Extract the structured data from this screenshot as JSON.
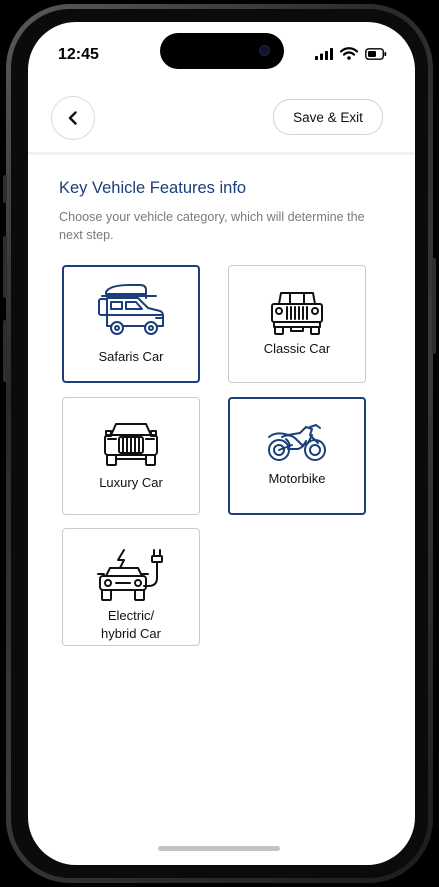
{
  "status_bar": {
    "time": "12:45"
  },
  "header": {
    "save_exit_label": "Save & Exit"
  },
  "content": {
    "title": "Key Vehicle Features info",
    "subtitle": "Choose your vehicle category, which will determine the next step."
  },
  "categories": [
    {
      "label": "Safaris Car",
      "icon": "safari-car-icon",
      "selected": true
    },
    {
      "label": "Classic Car",
      "icon": "classic-car-icon",
      "selected": false
    },
    {
      "label": "Luxury Car",
      "icon": "luxury-car-icon",
      "selected": false
    },
    {
      "label": "Motorbike",
      "icon": "motorbike-icon",
      "selected": true
    },
    {
      "label": "Electric/ hybrid Car",
      "label_lines": [
        "Electric/",
        "hybrid Car"
      ],
      "icon": "electric-car-icon",
      "selected": false
    }
  ],
  "colors": {
    "accent": "#1b3f7a",
    "card_border": "#c9cbce",
    "text_muted": "#777b80"
  }
}
